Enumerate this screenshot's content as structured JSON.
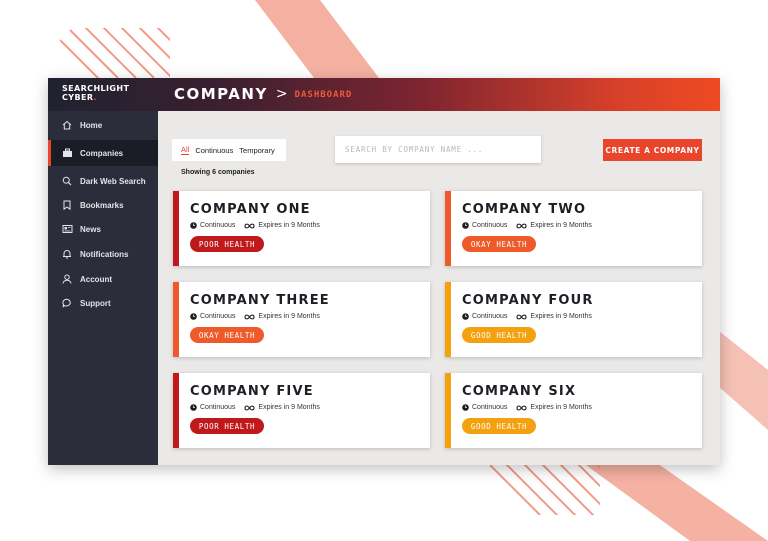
{
  "app": {
    "logo_line1": "SEARCHLIGHT",
    "logo_line2": "CYBER",
    "logo_dot": "."
  },
  "breadcrumb": {
    "main": "COMPANY",
    "separator": ">",
    "sub": "DASHBOARD"
  },
  "sidebar": {
    "items": [
      {
        "label": "Home",
        "icon": "home-icon",
        "active": false
      },
      {
        "label": "Companies",
        "icon": "companies-icon",
        "active": true
      },
      {
        "label": "Dark Web Search",
        "icon": "search-icon",
        "active": false
      },
      {
        "label": "Bookmarks",
        "icon": "bookmark-icon",
        "active": false
      },
      {
        "label": "News",
        "icon": "news-icon",
        "active": false
      },
      {
        "label": "Notifications",
        "icon": "bell-icon",
        "active": false
      },
      {
        "label": "Account",
        "icon": "user-icon",
        "active": false
      },
      {
        "label": "Support",
        "icon": "chat-icon",
        "active": false
      }
    ]
  },
  "filters": {
    "all": "All",
    "continuous": "Continuous",
    "temporary": "Temporary",
    "selected": "All"
  },
  "search": {
    "placeholder": "SEARCH BY COMPANY NAME ..."
  },
  "create_button": "CREATE A COMPANY",
  "showing": "Showing 6 companies",
  "colors": {
    "accent": "#e8452a",
    "poor": "#c0191c",
    "okay": "#ef5a2b",
    "good": "#f3a10f"
  },
  "companies": [
    {
      "name": "COMPANY ONE",
      "type": "Continuous",
      "expiry": "Expires in 9 Months",
      "health": "POOR HEALTH",
      "status": "poor"
    },
    {
      "name": "COMPANY TWO",
      "type": "Continuous",
      "expiry": "Expires in 9 Months",
      "health": "OKAY HEALTH",
      "status": "okay"
    },
    {
      "name": "COMPANY THREE",
      "type": "Continuous",
      "expiry": "Expires in 9 Months",
      "health": "OKAY HEALTH",
      "status": "okay"
    },
    {
      "name": "COMPANY FOUR",
      "type": "Continuous",
      "expiry": "Expires in 9 Months",
      "health": "GOOD HEALTH",
      "status": "good"
    },
    {
      "name": "COMPANY FIVE",
      "type": "Continuous",
      "expiry": "Expires in 9 Months",
      "health": "POOR HEALTH",
      "status": "poor"
    },
    {
      "name": "COMPANY SIX",
      "type": "Continuous",
      "expiry": "Expires in 9 Months",
      "health": "GOOD HEALTH",
      "status": "good"
    }
  ]
}
